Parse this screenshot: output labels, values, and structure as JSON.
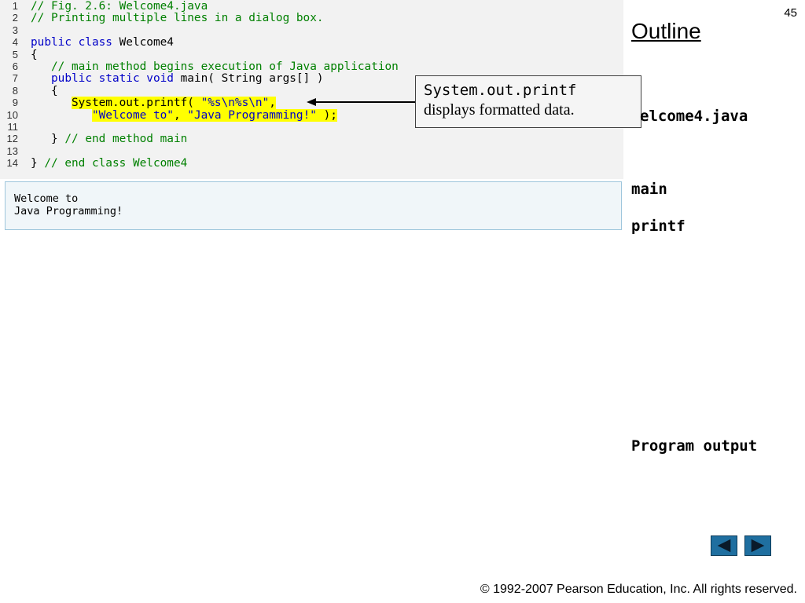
{
  "slide_number": "45",
  "outline": {
    "title": "Outline",
    "filename": "elcome4.java",
    "item_main": "main",
    "item_printf": "printf",
    "program_output": "Program output"
  },
  "code": {
    "lines": [
      {
        "num": "1",
        "segments": [
          {
            "t": "// Fig. 2.6: Welcome4.java",
            "c": "cm"
          }
        ]
      },
      {
        "num": "2",
        "segments": [
          {
            "t": "// Printing multiple lines in a dialog box.",
            "c": "cm"
          }
        ]
      },
      {
        "num": "3",
        "segments": []
      },
      {
        "num": "4",
        "segments": [
          {
            "t": "public class ",
            "c": "kw"
          },
          {
            "t": "Welcome4",
            "c": "tx"
          }
        ]
      },
      {
        "num": "5",
        "segments": [
          {
            "t": "{",
            "c": "tx"
          }
        ]
      },
      {
        "num": "6",
        "segments": [
          {
            "t": "   // main method begins execution of Java application",
            "c": "cm"
          }
        ]
      },
      {
        "num": "7",
        "segments": [
          {
            "t": "   ",
            "c": "tx"
          },
          {
            "t": "public static void ",
            "c": "kw"
          },
          {
            "t": "main( String args[] )",
            "c": "tx"
          }
        ]
      },
      {
        "num": "8",
        "segments": [
          {
            "t": "   {",
            "c": "tx"
          }
        ]
      },
      {
        "num": "9",
        "segments": [
          {
            "t": "      ",
            "c": "tx"
          },
          {
            "t": "System.out.printf( ",
            "c": "tx hl"
          },
          {
            "t": "\"%s\\n%s\\n\"",
            "c": "str hl"
          },
          {
            "t": ",",
            "c": "tx hl"
          }
        ]
      },
      {
        "num": "10",
        "segments": [
          {
            "t": "         ",
            "c": "tx"
          },
          {
            "t": "\"Welcome to\"",
            "c": "str hl"
          },
          {
            "t": ", ",
            "c": "tx hl"
          },
          {
            "t": "\"Java Programming!\"",
            "c": "str hl"
          },
          {
            "t": " );",
            "c": "tx hl"
          }
        ]
      },
      {
        "num": "11",
        "segments": []
      },
      {
        "num": "12",
        "segments": [
          {
            "t": "   } ",
            "c": "tx"
          },
          {
            "t": "// end method main",
            "c": "cm"
          }
        ]
      },
      {
        "num": "13",
        "segments": []
      },
      {
        "num": "14",
        "segments": [
          {
            "t": "} ",
            "c": "tx"
          },
          {
            "t": "// end class Welcome4",
            "c": "cm"
          }
        ]
      }
    ]
  },
  "output": {
    "line1": "Welcome to",
    "line2": "Java Programming!"
  },
  "callout": {
    "code_text": "System.out.printf",
    "desc": "displays formatted data."
  },
  "footer": "© 1992-2007 Pearson Education, Inc.  All rights reserved.",
  "nav": {
    "prev_icon": "triangle-left-icon",
    "next_icon": "triangle-right-icon"
  }
}
